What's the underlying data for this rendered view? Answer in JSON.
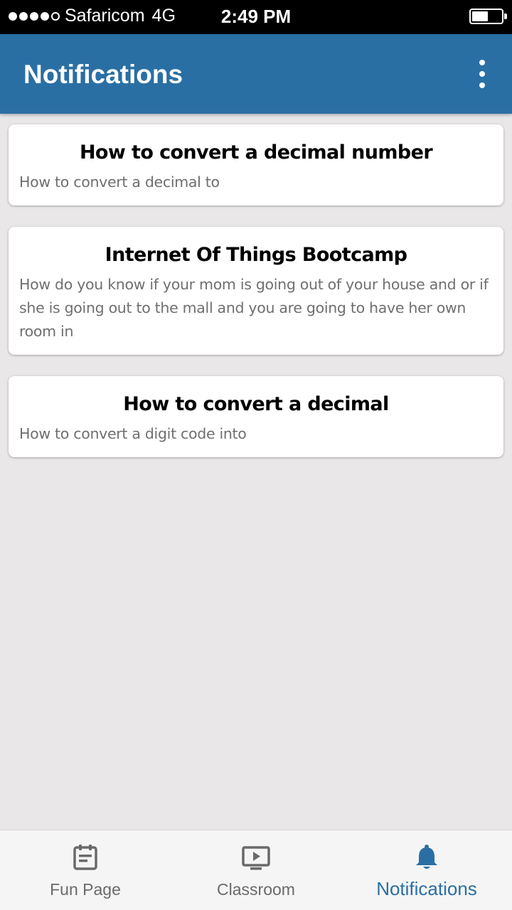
{
  "status_bar": {
    "carrier": "Safaricom",
    "network": "4G",
    "time": "2:49 PM",
    "signal_bars": 4,
    "battery_level": 0.55
  },
  "app_bar": {
    "title": "Notifications",
    "overflow_icon": "more-vert-icon"
  },
  "notifications": [
    {
      "title": "How to convert a decimal number",
      "body": "How to convert a decimal to"
    },
    {
      "title": "Internet Of Things Bootcamp",
      "body": "How do you know if your mom is going out of your house and or if she is going out to the mall and you are going to have her own room in"
    },
    {
      "title": "How to convert a decimal",
      "body": "How to convert a digit code into"
    }
  ],
  "tabs": [
    {
      "label": "Fun Page",
      "icon": "calendar-note-icon",
      "active": false
    },
    {
      "label": "Classroom",
      "icon": "video-player-icon",
      "active": false
    },
    {
      "label": "Notifications",
      "icon": "bell-icon",
      "active": true
    }
  ],
  "colors": {
    "accent": "#2a6fa4",
    "background": "#e9e7e8",
    "inactive_icon": "#6a6a6a"
  }
}
